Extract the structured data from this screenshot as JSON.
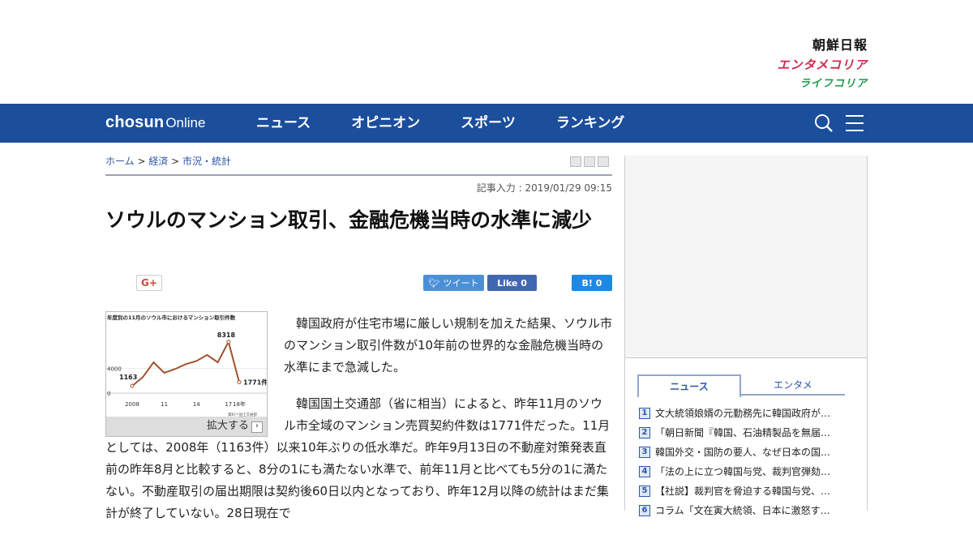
{
  "brand": {
    "chosun_ilbo": "朝鮮日報",
    "entame_korea": "エンタメコリア",
    "life_korea": "ライフコリア",
    "nav_color": "#1b4e9b"
  },
  "nav": {
    "logo_bold": "chosun",
    "logo_light": "Online",
    "items": [
      "ニュース",
      "オピニオン",
      "スポーツ",
      "ランキング"
    ],
    "icons": [
      "search-icon",
      "menu-icon"
    ]
  },
  "breadcrumb": {
    "home": "ホーム",
    "sep": " > ",
    "section": "経済",
    "subsection": "市況・統計"
  },
  "article": {
    "stamp": "記事入力 : 2019/01/29 09:15",
    "title": "ソウルのマンション取引、金融危機当時の水準に減少",
    "share": {
      "gplus": "G+",
      "tweet": "ツイート",
      "like": "Like 0",
      "hatena": "B! 0"
    },
    "paragraphs": [
      "韓国政府が住宅市場に厳しい規制を加えた結果、ソウル市のマンション取引件数が10年前の世界的な金融危機当時の水準にまで急減した。",
      "韓国国土交通部（省に相当）によると、昨年11月のソウル市全域のマンション売買契約件数は1771件だった。11月としては、2008年（1163件）以来10年ぶりの低水準だ。昨年9月13日の不動産対策発表直前の昨年8月と比較すると、8分の1にも満たない水準で、前年11月と比べても5分の1に満たない。不動産取引の届出期限は契約後60日以内となっており、昨年12月以降の統計はまだ集計が終了していない。28日現在で"
    ]
  },
  "figure": {
    "expand_label": "拡大する",
    "chart_data": {
      "type": "line",
      "title": "年度別の11月のソウル市におけるマンション取引件数",
      "x": [
        2008,
        2009,
        2010,
        2011,
        2012,
        2013,
        2014,
        2015,
        2016,
        2017,
        2018
      ],
      "x_tick_labels": [
        "2008",
        "11",
        "14",
        "17",
        "18年"
      ],
      "y_tick_labels": [
        "4000",
        "0"
      ],
      "values": [
        1163,
        2600,
        5000,
        3300,
        3900,
        4700,
        5200,
        6200,
        5000,
        8318,
        1771
      ],
      "data_labels": [
        "1163",
        "8318",
        "1771件"
      ],
      "ylim": [
        0,
        10000
      ],
      "source": "資料＝国土交通部",
      "line_color": "#a0522d"
    }
  },
  "sidebar": {
    "tabs": [
      "ニュース",
      "エンタメ"
    ],
    "ranking": [
      {
        "num": "1",
        "title": "文大統領娘婿の元勤務先に韓国政府が…"
      },
      {
        "num": "2",
        "title": "「朝日新聞『韓国、石油精製品を無届…"
      },
      {
        "num": "3",
        "title": "韓国外交・国防の要人、なぜ日本の国…"
      },
      {
        "num": "4",
        "title": "「法の上に立つ韓国与党、裁判官弾劾…"
      },
      {
        "num": "5",
        "title": "【社説】裁判官を脅迫する韓国与党、…"
      },
      {
        "num": "6",
        "title": "コラム「文在寅大統領、日本に激怒す…"
      }
    ]
  }
}
